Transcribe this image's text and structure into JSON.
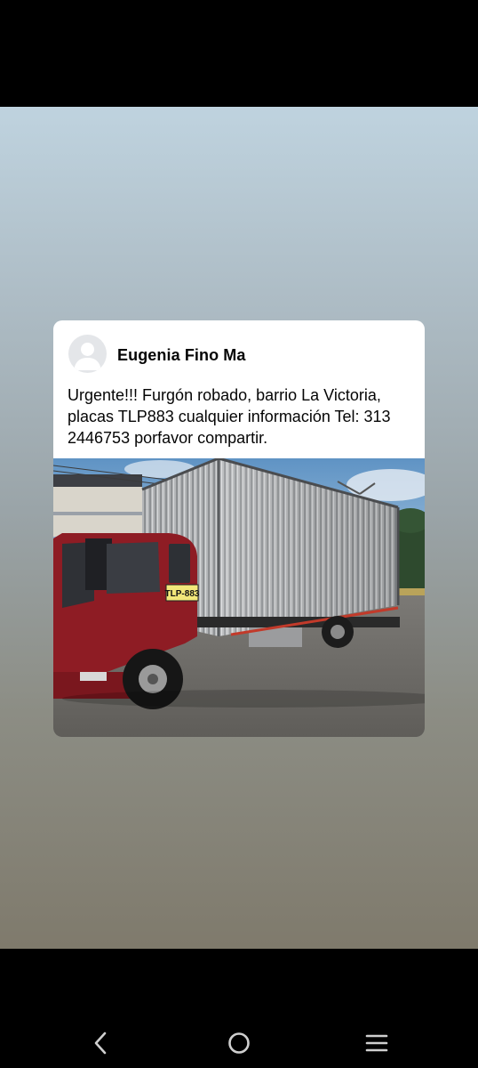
{
  "post": {
    "author": "Eugenia Fino Ma",
    "text": "Urgente!!! Furgón robado, barrio La Victoria, placas TLP883 cualquier información Tel: 313 2446753 porfavor compartir.",
    "photo": {
      "plate_text": "TLP-883"
    }
  },
  "system_nav": {
    "back_icon": "chevron-left-icon",
    "home_icon": "circle-home-icon",
    "recents_icon": "three-lines-icon"
  },
  "colors": {
    "card_background": "#ffffff",
    "text": "#050505",
    "truck_cab": "#8e1c24",
    "nav_icons": "#cfcfcf"
  }
}
